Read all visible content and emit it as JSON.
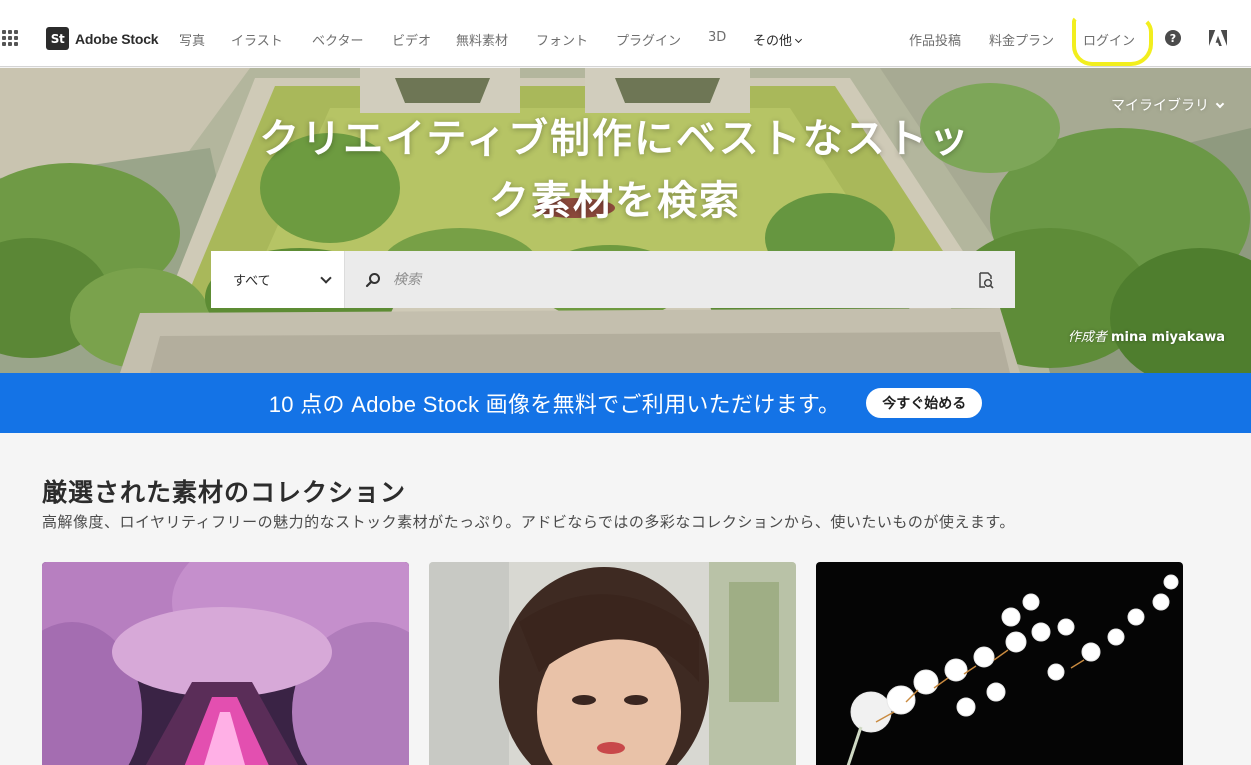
{
  "brand": {
    "badge": "St",
    "name": "Adobe Stock"
  },
  "nav": {
    "items": [
      "写真",
      "イラスト",
      "ベクター",
      "ビデオ",
      "無料素材",
      "フォント",
      "プラグイン",
      "3D"
    ],
    "more": "その他",
    "right": [
      "作品投稿",
      "料金プラン",
      "ログイン"
    ],
    "help": "?"
  },
  "hero": {
    "library": "マイライブラリ",
    "title": "クリエイティブ制作にベストなストック素材を検索",
    "search": {
      "scope": "すべて",
      "placeholder": "検索"
    },
    "credit_prefix": "作成者",
    "credit_author": "mina miyakawa"
  },
  "promo": {
    "text": "10 点の Adobe Stock 画像を無料でご利用いただけます。",
    "button": "今すぐ始める"
  },
  "collections": {
    "title": "厳選された素材のコレクション",
    "subtitle": "高解像度、ロイヤリティフリーの魅力的なストック素材がたっぷり。アドビならではの多彩なコレクションから、使いたいものが使えます。"
  },
  "colors": {
    "accent": "#1473e6",
    "highlight": "#f2ee1e",
    "text": "#2c2c2c"
  },
  "icons": [
    "apps-grid-icon",
    "chevron-down-icon",
    "help-icon",
    "adobe-logo-icon",
    "search-icon",
    "visual-search-icon"
  ]
}
